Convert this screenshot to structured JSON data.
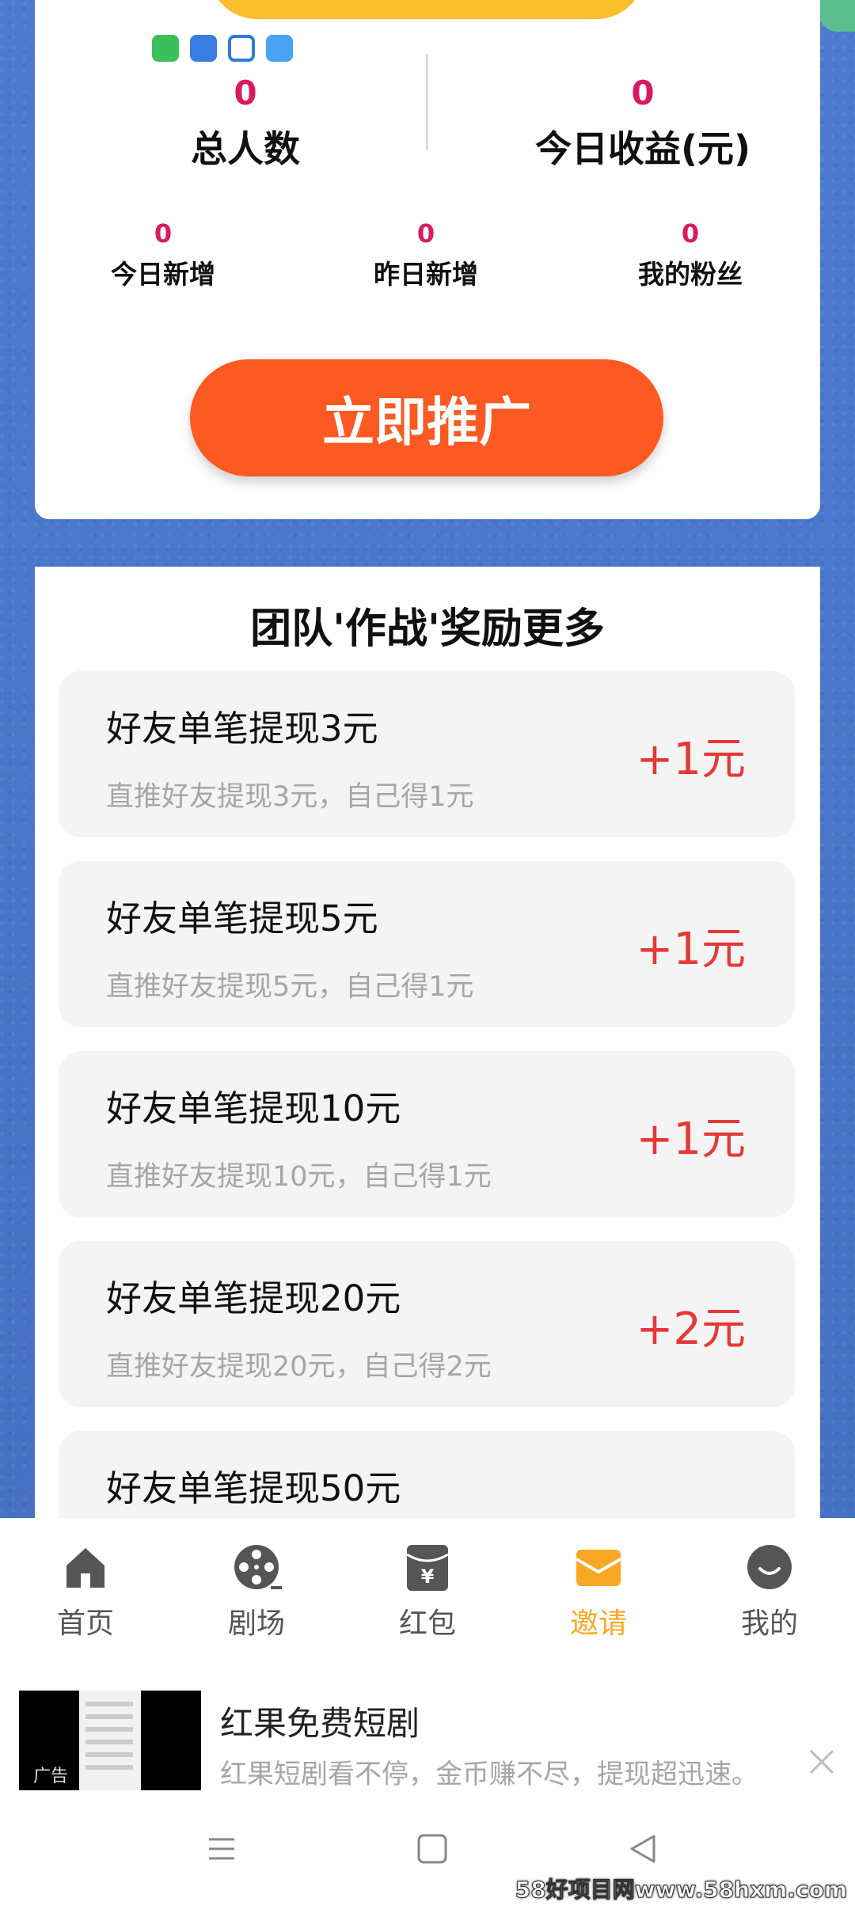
{
  "colors": {
    "page_bg": "#4a76c9",
    "accent_red": "#d81b60",
    "promote_orange": "#fc5a22",
    "reward_red": "#e53935",
    "active_tab": "#f9a825"
  },
  "stats": {
    "total_people_value": "0",
    "total_people_label": "总人数",
    "today_earnings_value": "0",
    "today_earnings_label": "今日收益(元)",
    "today_new_value": "0",
    "today_new_label": "今日新增",
    "yesterday_new_value": "0",
    "yesterday_new_label": "昨日新增",
    "fans_value": "0",
    "fans_label": "我的粉丝",
    "promote_button": "立即推广"
  },
  "rewards": {
    "title": "团队'作战'奖励更多",
    "items": [
      {
        "title": "好友单笔提现3元",
        "desc": "直推好友提现3元，自己得1元",
        "amount": "+1元"
      },
      {
        "title": "好友单笔提现5元",
        "desc": "直推好友提现5元，自己得1元",
        "amount": "+1元"
      },
      {
        "title": "好友单笔提现10元",
        "desc": "直推好友提现10元，自己得1元",
        "amount": "+1元"
      },
      {
        "title": "好友单笔提现20元",
        "desc": "直推好友提现20元，自己得2元",
        "amount": "+2元"
      },
      {
        "title": "好友单笔提现50元",
        "desc": "",
        "amount": ""
      }
    ]
  },
  "tabbar": {
    "tabs": [
      {
        "label": "首页",
        "icon": "home-icon"
      },
      {
        "label": "剧场",
        "icon": "film-reel-icon"
      },
      {
        "label": "红包",
        "icon": "red-envelope-icon"
      },
      {
        "label": "邀请",
        "icon": "invite-envelope-icon",
        "active": true
      },
      {
        "label": "我的",
        "icon": "profile-smile-icon"
      }
    ]
  },
  "ad": {
    "tag": "广告",
    "title": "红果免费短剧",
    "desc": "红果短剧看不停，金币赚不尽，提现超迅速。"
  },
  "watermark": "58好项目网www.58hxm.com"
}
